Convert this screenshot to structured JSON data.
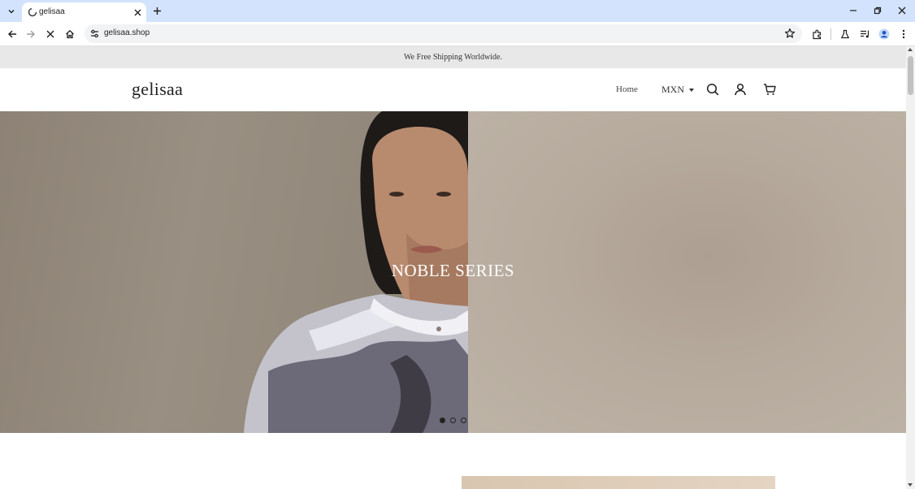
{
  "browser": {
    "tab_title": "gelisaa",
    "url": "gelisaa.shop",
    "icons": {
      "tab_list": "chevron-down-icon",
      "close_tab": "close-icon",
      "new_tab": "plus-icon",
      "back": "arrow-left-icon",
      "forward": "arrow-right-icon",
      "stop": "close-icon",
      "home": "home-icon",
      "site_info": "tune-icon",
      "bookmark": "star-icon",
      "extensions": "puzzle-icon",
      "labs": "flask-icon",
      "media": "queue-music-icon",
      "profile": "avatar-icon",
      "menu": "kebab-menu-icon"
    }
  },
  "page": {
    "announcement": "We Free Shipping Worldwide.",
    "logo": "gelisaa",
    "nav": {
      "home": "Home",
      "currency": "MXN"
    },
    "hero": {
      "title": "NOBLE SERIES",
      "slide_count": 3,
      "active_slide": 1
    }
  },
  "colors": {
    "tabbar_bg": "#d3e3fd",
    "announcement_bg": "#e8e8e8",
    "text_dark": "#222222"
  }
}
